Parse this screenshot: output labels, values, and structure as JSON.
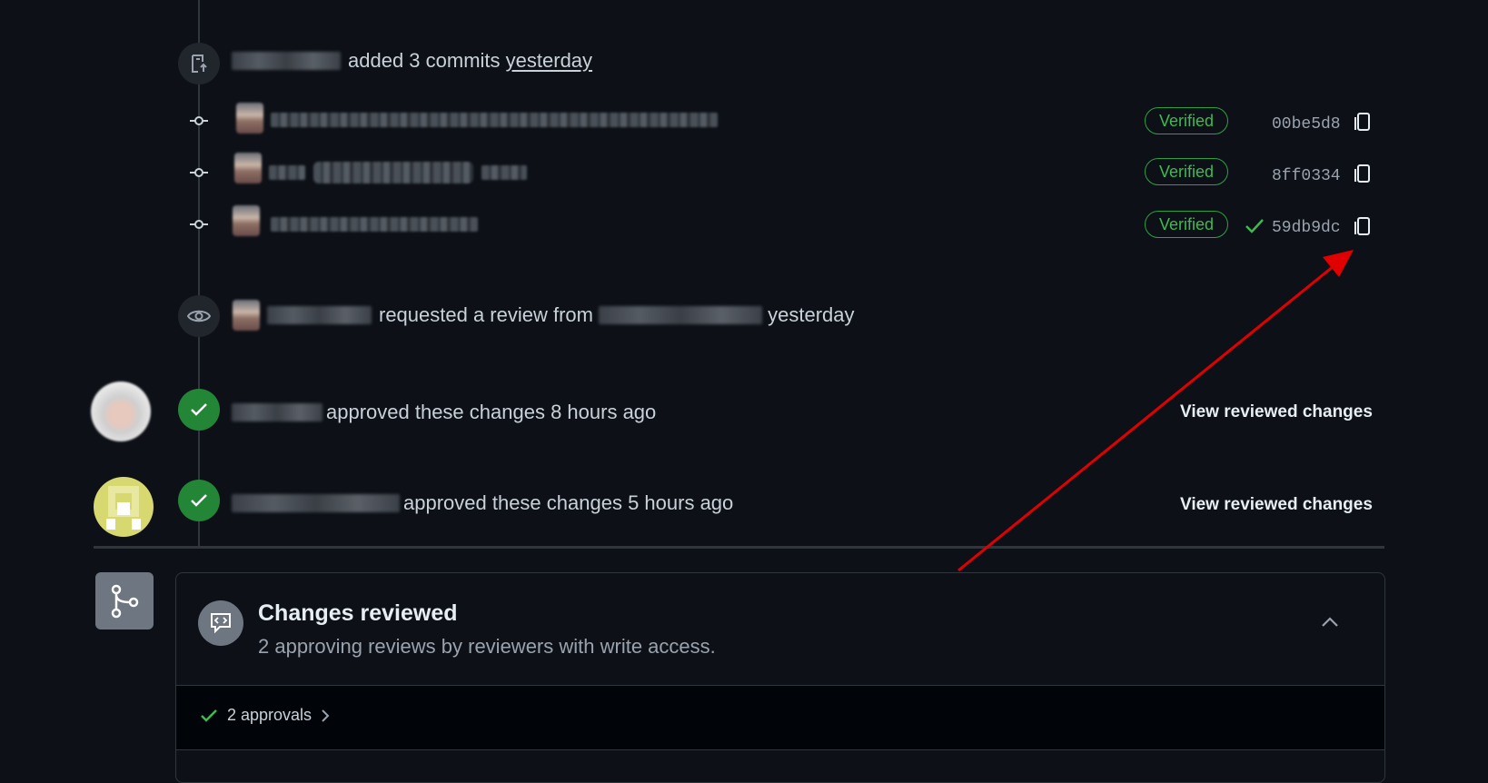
{
  "events": {
    "commits_added": {
      "action": "added 3 commits",
      "time": "yesterday"
    },
    "commits": [
      {
        "verified": "Verified",
        "sha": "00be5d8",
        "check": false
      },
      {
        "verified": "Verified",
        "sha": "8ff0334",
        "check": false
      },
      {
        "verified": "Verified",
        "sha": "59db9dc",
        "check": true
      }
    ],
    "review_request": {
      "action": "requested a review from",
      "time": "yesterday"
    },
    "approvals": [
      {
        "text": "approved these changes 8 hours ago",
        "link": "View reviewed changes"
      },
      {
        "text": "approved these changes 5 hours ago",
        "link": "View reviewed changes"
      }
    ]
  },
  "merge_panel": {
    "title": "Changes reviewed",
    "description": "2 approving reviews by reviewers with write access.",
    "approvals_label": "2 approvals"
  },
  "colors": {
    "background": "#0d1117",
    "success": "#3fb950",
    "annotation_arrow": "#e00000"
  },
  "icons": [
    "push-icon",
    "commit-icon",
    "eye-icon",
    "check-icon",
    "copy-icon",
    "git-merge-icon",
    "comment-code-icon",
    "chevron-up-icon",
    "chevron-right-icon"
  ]
}
